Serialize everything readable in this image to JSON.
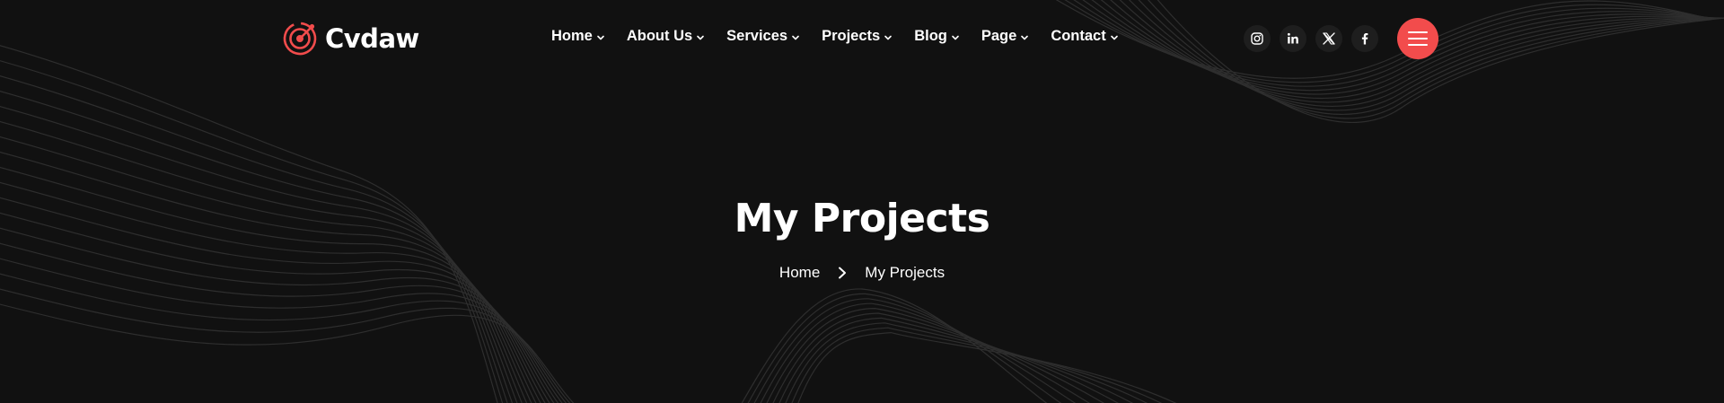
{
  "brand": {
    "name": "Cvdaw",
    "accent_color": "#f24c4c",
    "logo_icon": "target-icon"
  },
  "nav": {
    "items": [
      {
        "label": "Home",
        "icon": "chevron-down-icon"
      },
      {
        "label": "About Us",
        "icon": "chevron-down-icon"
      },
      {
        "label": "Services",
        "icon": "chevron-down-icon"
      },
      {
        "label": "Projects",
        "icon": "chevron-down-icon"
      },
      {
        "label": "Blog",
        "icon": "chevron-down-icon"
      },
      {
        "label": "Page",
        "icon": "chevron-down-icon"
      },
      {
        "label": "Contact",
        "icon": "chevron-down-icon"
      }
    ]
  },
  "socials": [
    "instagram-icon",
    "linkedin-icon",
    "x-twitter-icon",
    "facebook-icon"
  ],
  "menu_button": {
    "icon": "hamburger-menu-icon",
    "color": "#f24c4c"
  },
  "hero": {
    "title": "My Projects",
    "breadcrumb": {
      "home": "Home",
      "separator_icon": "chevron-right-icon",
      "current": "My Projects"
    }
  },
  "colors": {
    "background": "#111111",
    "text": "#ffffff",
    "wave_lines": "#2e2e2e"
  }
}
